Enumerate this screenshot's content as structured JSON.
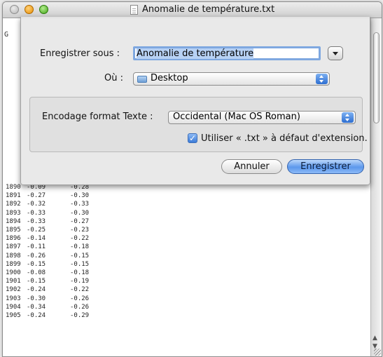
{
  "window": {
    "title": "Anomalie de température.txt"
  },
  "sheet": {
    "save_as_label": "Enregistrer sous :",
    "filename_value": "Anomalie de température",
    "where_label": "Où :",
    "where_value": "Desktop",
    "encoding_label": "Encodage format Texte :",
    "encoding_value": "Occidental (Mac OS Roman)",
    "checkbox_label": "Utiliser « .txt » à défaut d'extension.",
    "checkbox_checked": true,
    "cancel_label": "Annuler",
    "save_label": "Enregistrer"
  },
  "document": {
    "first_char": "G",
    "rows": [
      [
        "1890",
        "-0.09",
        "-0.28"
      ],
      [
        "1891",
        "-0.27",
        "-0.30"
      ],
      [
        "1892",
        "-0.32",
        "-0.33"
      ],
      [
        "1893",
        "-0.33",
        "-0.30"
      ],
      [
        "1894",
        "-0.33",
        "-0.27"
      ],
      [
        "1895",
        "-0.25",
        "-0.23"
      ],
      [
        "1896",
        "-0.14",
        "-0.22"
      ],
      [
        "1897",
        "-0.11",
        "-0.18"
      ],
      [
        "1898",
        "-0.26",
        "-0.15"
      ],
      [
        "1899",
        "-0.15",
        "-0.15"
      ],
      [
        "1900",
        "-0.08",
        "-0.18"
      ],
      [
        "1901",
        "-0.15",
        "-0.19"
      ],
      [
        "1902",
        "-0.24",
        "-0.22"
      ],
      [
        "1903",
        "-0.30",
        "-0.26"
      ],
      [
        "1904",
        "-0.34",
        "-0.26"
      ],
      [
        "1905",
        "-0.24",
        "-0.29"
      ]
    ]
  },
  "colors": {
    "accent": "#5c98ec",
    "sheet_bg": "#e7e7e7"
  }
}
